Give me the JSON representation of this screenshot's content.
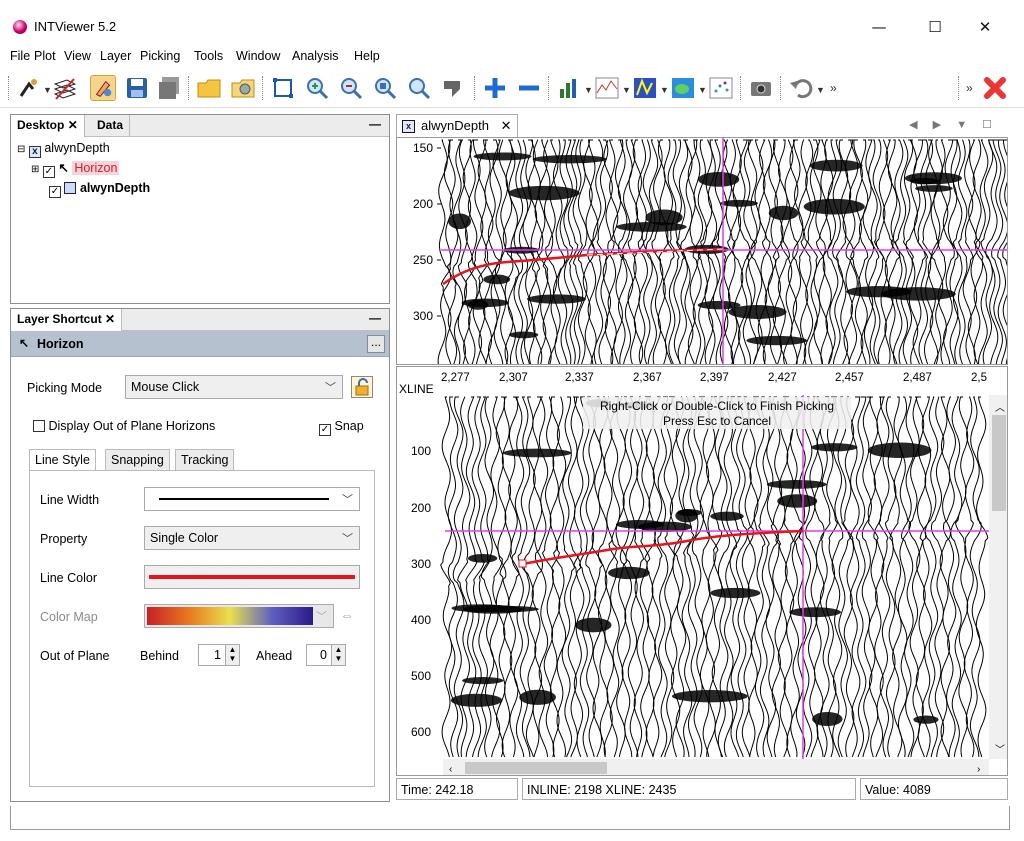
{
  "window": {
    "title": "INTViewer 5.2",
    "minimize": "—",
    "maximize": "☐",
    "close": "✕"
  },
  "menu": [
    "File",
    "Plot",
    "View",
    "Layer",
    "Picking",
    "Tools",
    "Window",
    "Analysis",
    "Help"
  ],
  "toolbar": {
    "icons": [
      "horizon-picking-icon",
      "layers-icon",
      "picking-cursor-icon",
      "save-icon",
      "save-all-icon",
      "open-folder-icon",
      "open-session-icon",
      "fit-view-icon",
      "zoom-in-icon",
      "zoom-out-icon",
      "zoom-region-icon",
      "zoom-reset-icon",
      "pan-icon",
      "add-icon",
      "remove-icon",
      "bar-chart-icon",
      "spectrum-icon",
      "colormap-icon",
      "map-icon",
      "crossplot-icon",
      "camera-icon",
      "undo-icon",
      "close-red-icon"
    ],
    "overflow": "»"
  },
  "desktop_panel": {
    "tabs": [
      "Desktop",
      "Data"
    ],
    "minimize": "—",
    "tree": {
      "root": "alwynDepth",
      "children": [
        {
          "label": "Horizon",
          "checked": true,
          "highlight": true
        },
        {
          "label": "alwynDepth",
          "checked": true,
          "bold": true
        }
      ]
    }
  },
  "layer_shortcut": {
    "tab": "Layer Shortcut",
    "minimize": "—",
    "header": "Horizon",
    "more": "...",
    "picking_mode_label": "Picking Mode",
    "picking_mode_value": "Mouse Click",
    "display_out_of_plane": "Display Out of Plane Horizons",
    "display_out_of_plane_checked": false,
    "snap": "Snap",
    "snap_checked": true,
    "subtabs": [
      "Line Style",
      "Snapping",
      "Tracking"
    ],
    "line_width_label": "Line Width",
    "property_label": "Property",
    "property_value": "Single Color",
    "line_color_label": "Line Color",
    "line_color": "#e8141d",
    "color_map_label": "Color Map",
    "out_of_plane_label": "Out of Plane",
    "behind_label": "Behind",
    "behind_value": "1",
    "ahead_label": "Ahead",
    "ahead_value": "0"
  },
  "view": {
    "tab": "alwynDepth",
    "top_y_ticks": [
      "150",
      "200",
      "250",
      "300"
    ],
    "bottom_axis_label": "XLINE",
    "x_ticks": [
      "2,277",
      "2,307",
      "2,337",
      "2,367",
      "2,397",
      "2,427",
      "2,457",
      "2,487",
      "2,5"
    ],
    "bottom_y_ticks": [
      "100",
      "200",
      "300",
      "400",
      "500",
      "600"
    ],
    "hint_line1": "Right-Click or Double-Click to Finish Picking",
    "hint_line2": "Press Esc to Cancel",
    "crosshair_color": "#e23fe8",
    "horizon_color": "#e8141d"
  },
  "status": {
    "time": "Time: 242.18",
    "position": "INLINE: 2198 XLINE: 2435",
    "value_label": "Value:",
    "value": "4089"
  }
}
